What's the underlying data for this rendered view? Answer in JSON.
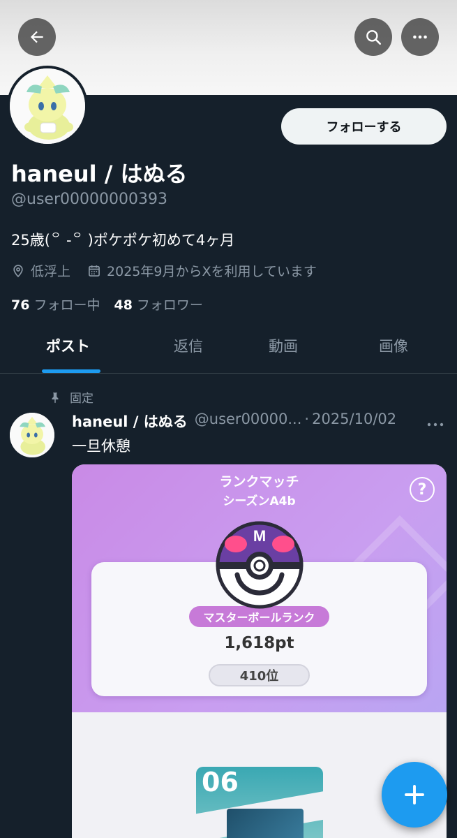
{
  "header": {
    "back_icon": "arrow-left-icon",
    "search_icon": "search-icon",
    "more_icon": "more-horizontal-icon"
  },
  "profile": {
    "display_name": "haneul / はぬる",
    "handle": "@user00000000393",
    "follow_label": "フォローする",
    "bio": "25歳(꒪ -꒪ )ポケポケ初めて4ヶ月",
    "location": "低浮上",
    "joined": "2025年9月からXを利用しています",
    "following_count": "76",
    "following_label": "フォロー中",
    "followers_count": "48",
    "followers_label": "フォロワー"
  },
  "tabs": [
    {
      "label": "ポスト",
      "active": true
    },
    {
      "label": "返信",
      "active": false
    },
    {
      "label": "動画",
      "active": false
    },
    {
      "label": "画像",
      "active": false
    }
  ],
  "post": {
    "pinned_label": "固定",
    "name": "haneul / はぬる",
    "handle": "@user00000...",
    "separator": "·",
    "date": "2025/10/02",
    "text": "一旦休憩",
    "media": {
      "title_line1": "ランクマッチ",
      "title_line2": "シーズンA4b",
      "help": "?",
      "rank_label": "マスターボールランク",
      "points": "1,618pt",
      "position": "410位",
      "pack_number": "06",
      "ball_letter": "M"
    }
  },
  "fab": {
    "icon": "plus-icon"
  },
  "colors": {
    "background": "#15202b",
    "accent": "#1d9bf0",
    "muted": "#8b98a5"
  }
}
